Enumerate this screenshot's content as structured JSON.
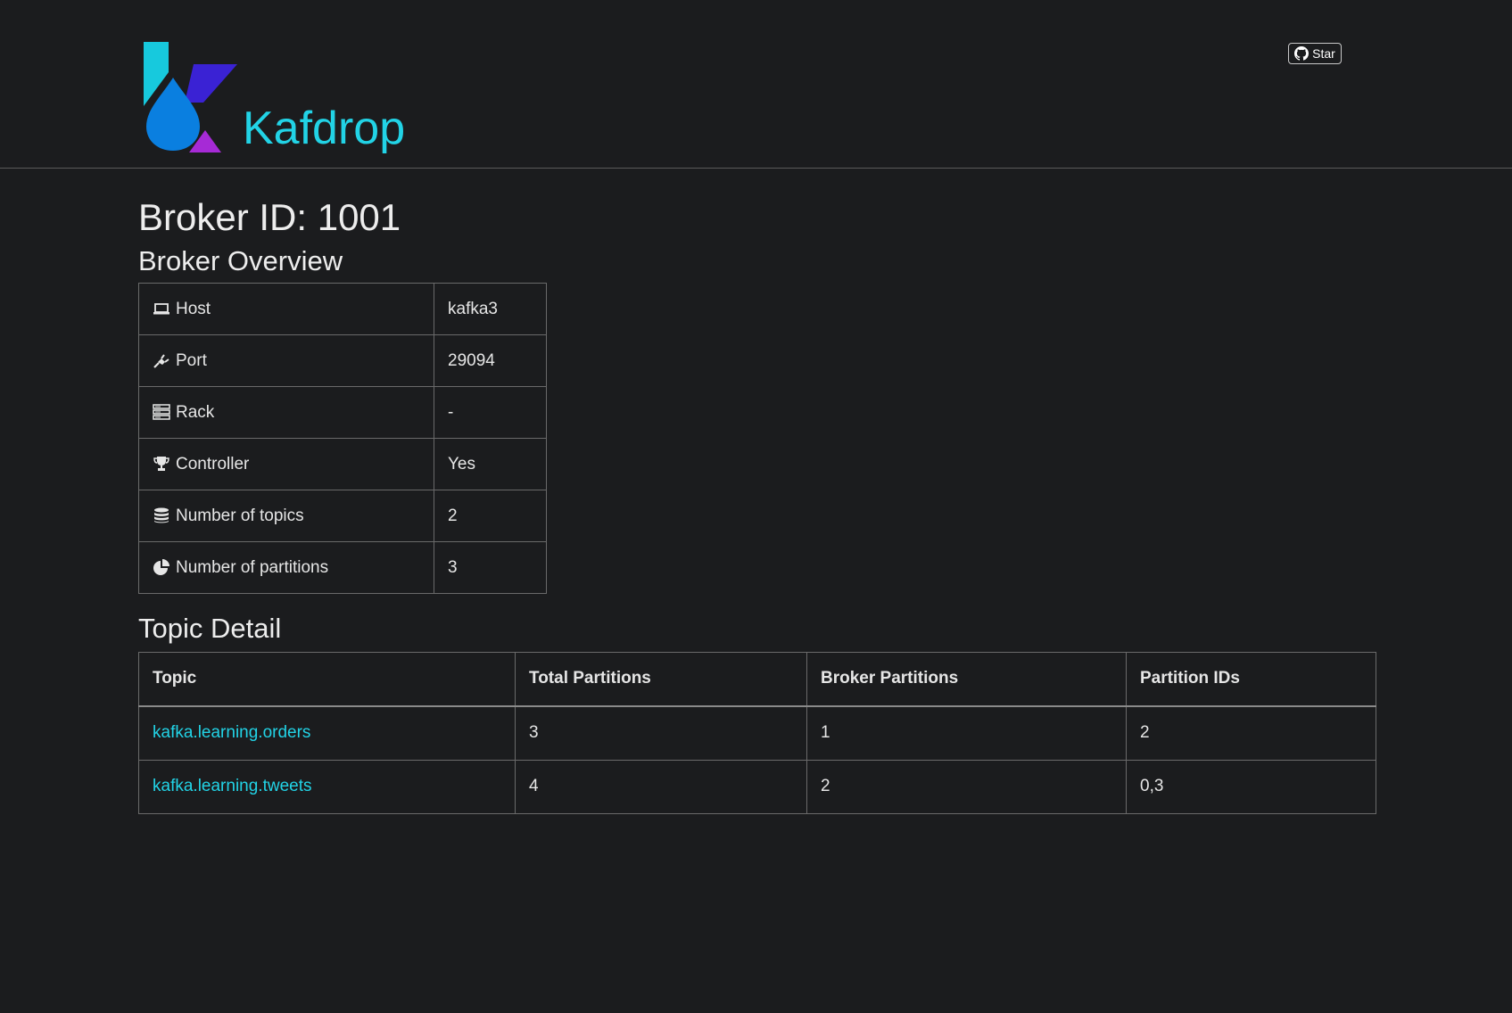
{
  "header": {
    "brand": "Kafdrop",
    "star_label": "Star"
  },
  "page": {
    "title": "Broker ID: 1001",
    "overview_heading": "Broker Overview",
    "topic_detail_heading": "Topic Detail"
  },
  "overview": [
    {
      "icon": "laptop-icon",
      "label": "Host",
      "value": "kafka3"
    },
    {
      "icon": "plug-icon",
      "label": "Port",
      "value": "29094"
    },
    {
      "icon": "server-icon",
      "label": "Rack",
      "value": "-"
    },
    {
      "icon": "trophy-icon",
      "label": "Controller",
      "value": "Yes"
    },
    {
      "icon": "database-icon",
      "label": "Number of topics",
      "value": "2"
    },
    {
      "icon": "pie-chart-icon",
      "label": "Number of partitions",
      "value": "3"
    }
  ],
  "topic_table": {
    "headers": [
      "Topic",
      "Total Partitions",
      "Broker Partitions",
      "Partition IDs"
    ],
    "rows": [
      {
        "topic": "kafka.learning.orders",
        "total": "3",
        "broker": "1",
        "ids": "2"
      },
      {
        "topic": "kafka.learning.tweets",
        "total": "4",
        "broker": "2",
        "ids": "0,3"
      }
    ]
  },
  "colors": {
    "background": "#1b1c1e",
    "accent": "#22d3e6",
    "text": "#e6e6e6"
  }
}
